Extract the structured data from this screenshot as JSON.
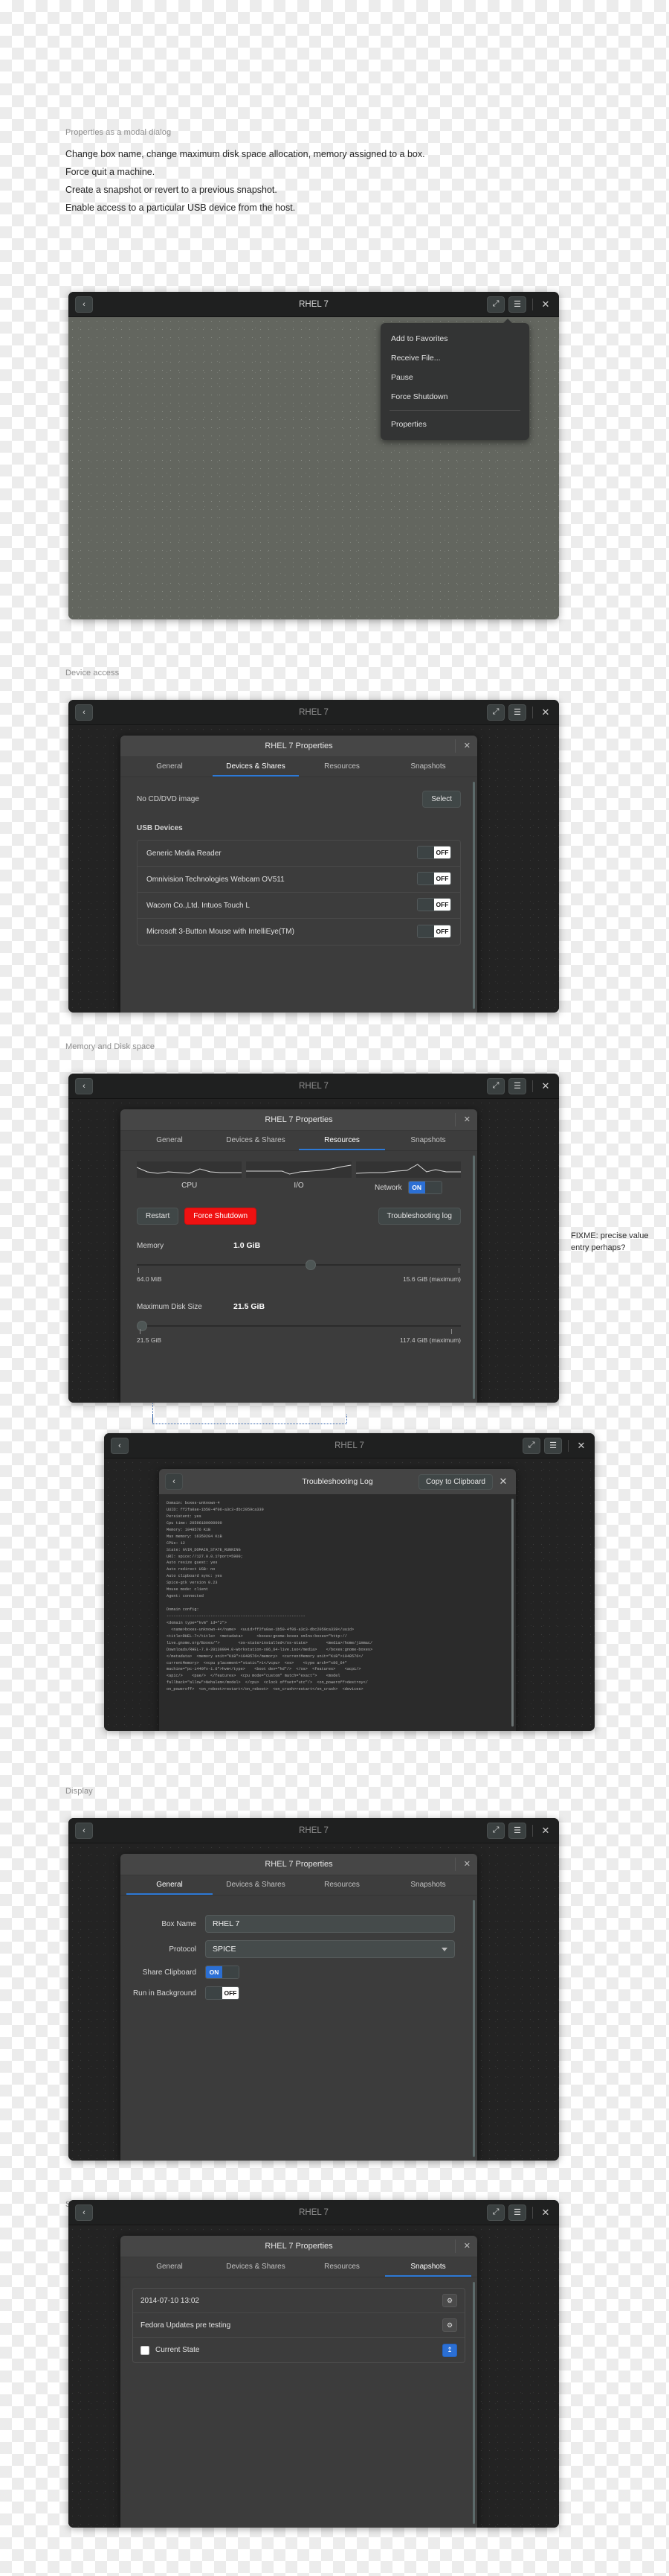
{
  "sections": {
    "modal_caption": "Properties as a modal dialog",
    "device_caption": "Device access",
    "memory_caption": "Memory and Disk space",
    "display_caption": "Display",
    "snapshots_caption": "Snapshots"
  },
  "intro_lines": [
    "Change box name, change maximum disk space allocation, memory assigned to a box.",
    "Force quit a machine.",
    "Create a snapshot or revert to a previous snapshot.",
    "Enable access to a particular USB device from the host."
  ],
  "fixme_note": "FIXME: precise value entry perhaps?",
  "window": {
    "title": "RHEL 7",
    "back_icon": "‹",
    "fullscreen_icon": "⤢",
    "menu_icon": "☰",
    "close_icon": "✕"
  },
  "context_menu": {
    "items": [
      {
        "label": "Add to Favorites"
      },
      {
        "label": "Receive File..."
      },
      {
        "label": "Pause"
      },
      {
        "label": "Force Shutdown"
      }
    ],
    "properties_label": "Properties"
  },
  "properties": {
    "title": "RHEL 7 Properties",
    "close_icon": "✕",
    "tabs": [
      "General",
      "Devices & Shares",
      "Resources",
      "Snapshots"
    ]
  },
  "devices_tab": {
    "cd_label": "No CD/DVD image",
    "select_button": "Select",
    "usb_header": "USB Devices",
    "usb_devices": [
      {
        "name": "Generic Media Reader",
        "state": "OFF"
      },
      {
        "name": "Omnivision Technologies Webcam OV511",
        "state": "OFF"
      },
      {
        "name": "Wacom Co.,Ltd. Intuos Touch L",
        "state": "OFF"
      },
      {
        "name": "Microsoft 3-Button Mouse with IntelliEye(TM)",
        "state": "OFF"
      }
    ]
  },
  "resources_tab": {
    "graphs": [
      {
        "label": "CPU"
      },
      {
        "label": "I/O"
      },
      {
        "label": "Network"
      }
    ],
    "network_state": "ON",
    "restart_button": "Restart",
    "force_shutdown_button": "Force Shutdown",
    "troubleshooting_button": "Troubleshooting log",
    "memory": {
      "label": "Memory",
      "value": "1.0 GiB",
      "min": "64.0 MiB",
      "max": "15.6 GiB (maximum)"
    },
    "disk": {
      "label": "Maximum Disk Size",
      "value": "21.5 GiB",
      "min": "21.5 GiB",
      "max": "117.4 GiB (maximum)"
    }
  },
  "troubleshooting": {
    "back_icon": "‹",
    "title": "Troubleshooting Log",
    "copy_button": "Copy to Clipboard",
    "close_icon": "✕",
    "log": "Domain: boxes-unknown-4\nUUID: ff2fa0ae-1b50-4f06-a3c3-dbc2059ca339\nPersistent: yes\nCpu time: 20596180000000\nMemory: 1048576 KiB\nMax memory: 16359204 KiB\nCPUs: 12\nState: GVIR_DOMAIN_STATE_RUNNING\nURI: spice://127.0.0.1?port=5900;\nAuto resize guest: yes\nAuto redirect USB: no\nAuto clipboard sync: yes\nSpice-gtk version 0.23\nMouse mode: client\nAgent: connected\n\nDomain config:\n------------------------------------------------------------\n<domain type=\"kvm\" id=\"2\">\n  <name>boxes-unknown-4</name>  <uuid>ff2fa0ae-1b50-4f06-a3c3-dbc2059ca339</uuid>\n<title>RHEL-7</title>  <metadata>      <boxes:gnome-boxes xmlns:boxes=\"http://\nlive.gnome.org/Boxes/\">        <os-state>installed</os-state>        <media>/home/jimmac/\nDownloads/RHEL-7.0-20130904.0-Workstation-x86_64-live.iso</media>    </boxes:gnome-boxes>\n</metadata>  <memory unit=\"KiB\">1048576</memory>  <currentMemory unit=\"KiB\">1048576</\ncurrentMemory>  <vcpu placement=\"static\">1</vcpu>  <os>    <type arch=\"x86_64\"\nmachine=\"pc-i440fx-1.6\">hvm</type>    <boot dev=\"hd\"/>  </os>  <features>    <acpi/>\n<apic/>    <pae/>  </features>  <cpu mode=\"custom\" match=\"exact\">    <model\nfallback=\"allow\">Nehalem</model>  </cpu>  <clock offset=\"utc\"/>  <on_poweroff>destroy</\non_poweroff>  <on_reboot>restart</on_reboot>  <on_crash>restart</on_crash>  <devices>"
  },
  "general_tab": {
    "box_name_label": "Box Name",
    "box_name_value": "RHEL 7",
    "protocol_label": "Protocol",
    "protocol_value": "SPICE",
    "share_clipboard_label": "Share Clipboard",
    "share_clipboard_state": "ON",
    "run_background_label": "Run in Background",
    "run_background_state": "OFF"
  },
  "snapshots_tab": {
    "rows": [
      {
        "label": "2014-07-10 13:02",
        "icon": "⚙",
        "checked": false,
        "accent": false
      },
      {
        "label": "Fedora Updates pre testing",
        "icon": "⚙",
        "checked": false,
        "accent": false
      },
      {
        "label": "Current State",
        "icon": "↥",
        "checked": true,
        "accent": true
      }
    ]
  },
  "colors": {
    "accent": "#2d79d6",
    "danger": "#ef1111",
    "titlebar": "#1f2020",
    "dialog": "#3c3c3c"
  }
}
